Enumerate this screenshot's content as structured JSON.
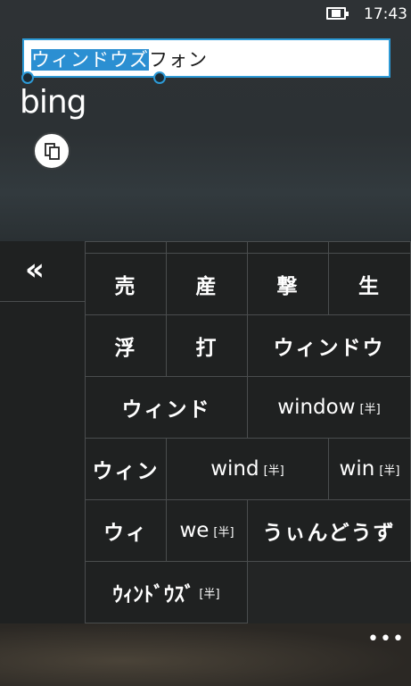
{
  "status_bar": {
    "time": "17:43",
    "battery_icon": "battery-charging-icon"
  },
  "search": {
    "selected_text": "ウィンドウズ",
    "remaining_text": "フォン"
  },
  "logo": {
    "text": "bing"
  },
  "copy_icon": "copy-icon",
  "keyboard": {
    "collapse_label": "«",
    "candidates": [
      {
        "text": "売"
      },
      {
        "text": "産"
      },
      {
        "text": "撃"
      },
      {
        "text": "生"
      },
      {
        "text": "浮"
      },
      {
        "text": "打"
      },
      {
        "text": "ウィンドウ"
      },
      {
        "text": "ウィンド"
      },
      {
        "text": "window",
        "tag": "[半]"
      },
      {
        "text": "ウィン"
      },
      {
        "text": "wind",
        "tag": "[半]"
      },
      {
        "text": "win",
        "tag": "[半]"
      },
      {
        "text": "ウィ"
      },
      {
        "text": "we",
        "tag": "[半]"
      },
      {
        "text": "うぃんどうず"
      },
      {
        "text": "ｳｨﾝﾄﾞｳｽﾞ",
        "tag": "[半]"
      }
    ]
  },
  "app_bar": {
    "more_label": "•••"
  }
}
